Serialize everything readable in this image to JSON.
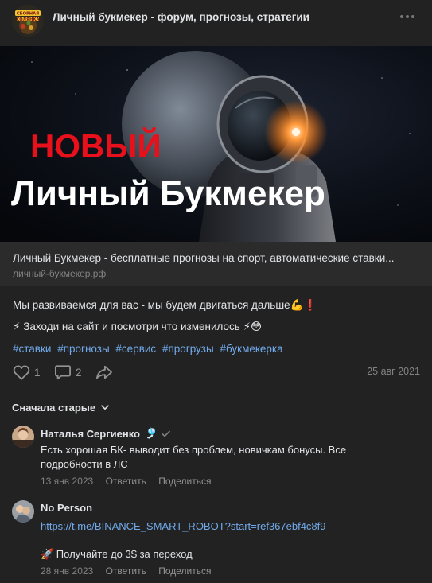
{
  "header": {
    "title": "Личный букмекер - форум, прогнозы, стратегии",
    "avatar_icon": "group-avatar",
    "avatar_text": "СБОРНАЯ СОЛЯНКА"
  },
  "card": {
    "banner_line1": "НОВЫЙ",
    "banner_line2": "Личный Букмекер",
    "title": "Личный Букмекер - бесплатные прогнозы на спорт, автоматические ставки...",
    "domain": "личный-букмекер.рф"
  },
  "post": {
    "line1": "Мы развиваемся для вас - мы будем двигаться дальше💪❗",
    "line2": "⚡ Заходи на сайт и посмотри что изменилось ⚡😳",
    "hashtags": [
      "#ставки",
      "#прогнозы",
      "#сервис",
      "#прогрузы",
      "#букмекерка"
    ]
  },
  "actions": {
    "likes": "1",
    "comments": "2",
    "date": "25 авг 2021"
  },
  "comments_section": {
    "sort_label": "Сначала старые",
    "items": [
      {
        "author": "Наталья Сергиенко",
        "badge": "🎐",
        "text": "Есть хорошая БК- выводит без проблем, новичкам бонусы. Все подробности в ЛС",
        "date": "13 янв 2023",
        "reply": "Ответить",
        "share": "Поделиться"
      },
      {
        "author": "No Person",
        "link": "https://t.me/BINANCE_SMART_ROBOT?start=ref367ebf4c8f9",
        "text": "🚀 Получайте до 3$ за переход",
        "date": "28 янв 2023",
        "reply": "Ответить",
        "share": "Поделиться"
      }
    ]
  },
  "colors": {
    "background": "#222222",
    "card": "#2b2b2c",
    "link": "#71aaeb",
    "muted": "#828282",
    "banner_red": "#e8101a"
  }
}
